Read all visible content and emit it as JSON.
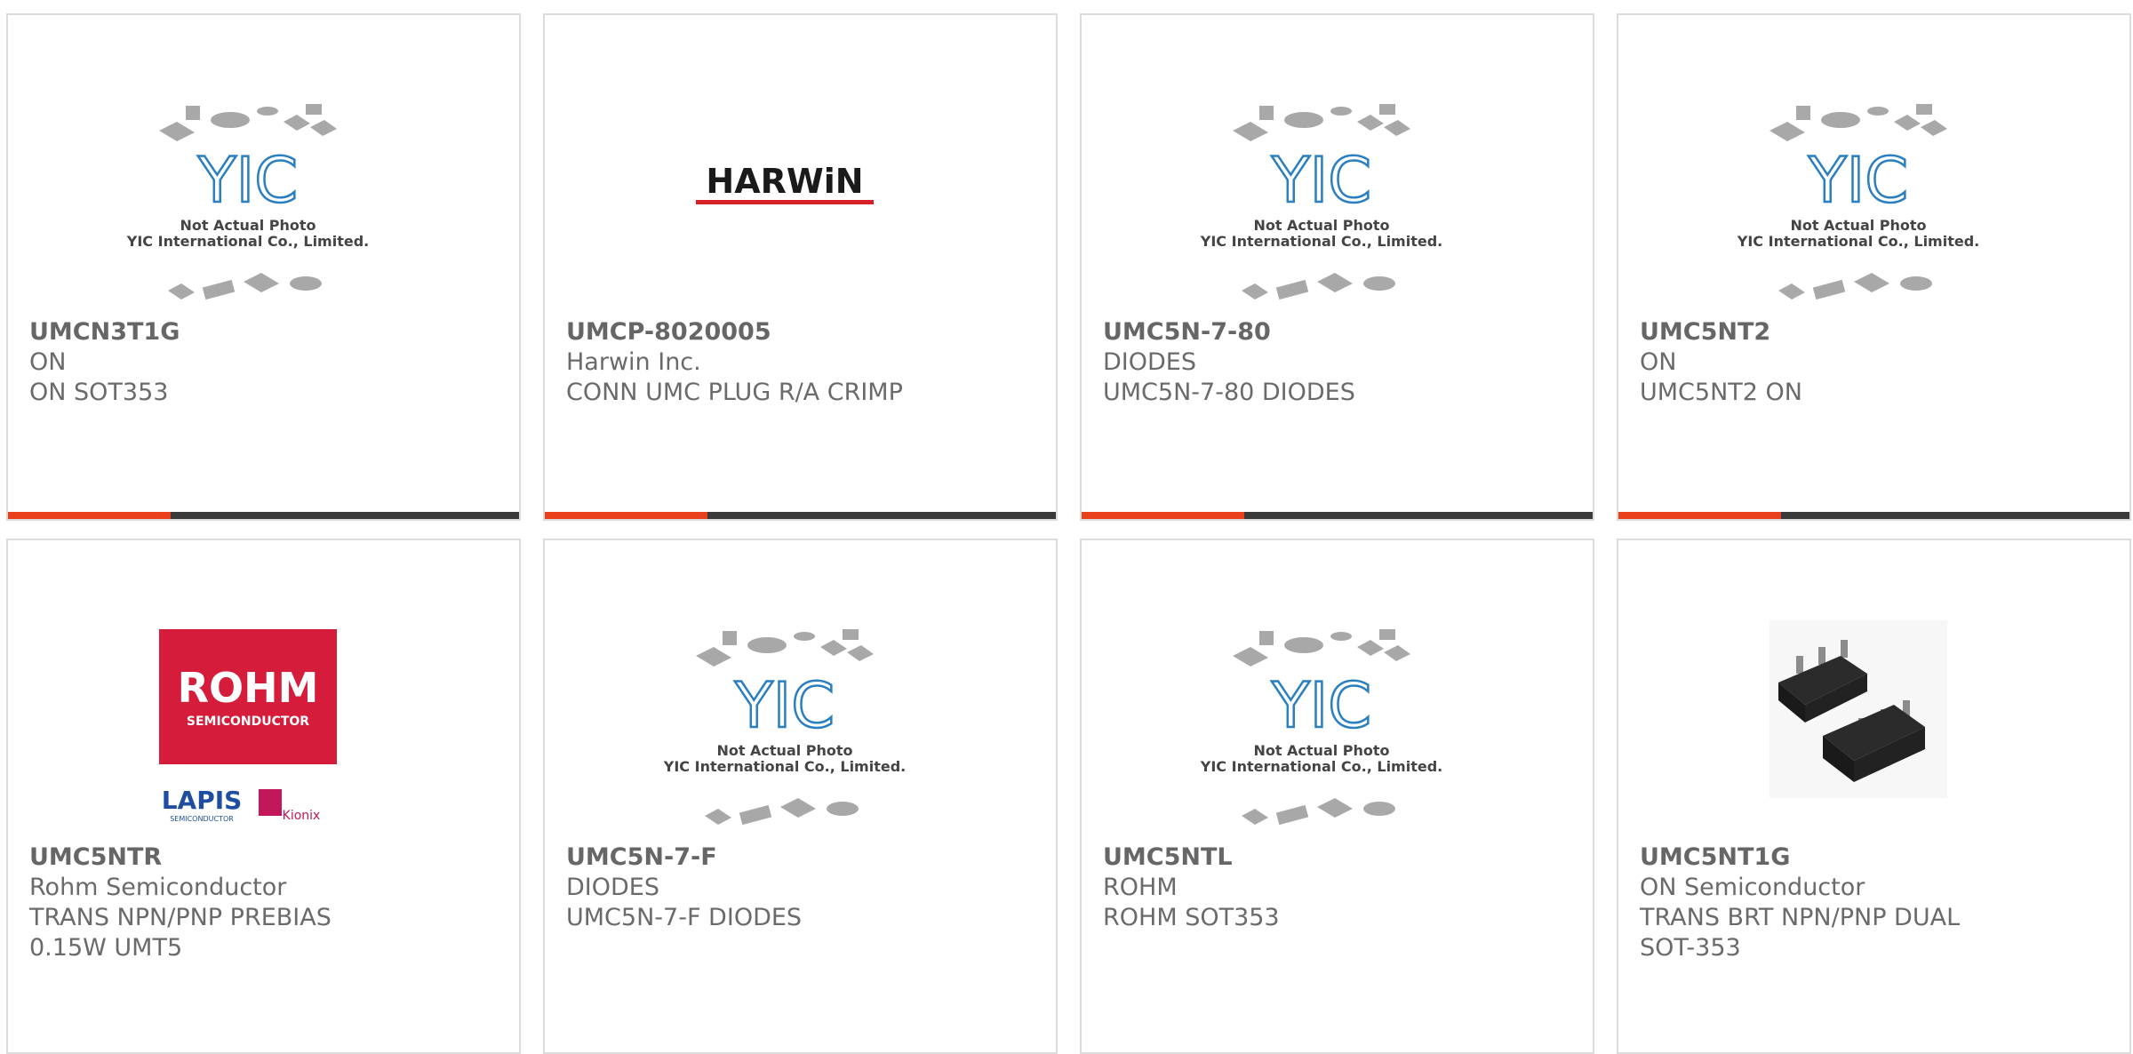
{
  "colors": {
    "accent": "#e8411b",
    "bar": "#3a3a3a",
    "border": "#dcdcdc",
    "text": "#666666",
    "yic_blue": "#2a7fc1",
    "rohm_red": "#d51c3a",
    "harwin_red": "#d52027"
  },
  "placeholder": {
    "line1": "Not Actual Photo",
    "line2": "YIC International Co., Limited.",
    "logo": "YIC"
  },
  "brands": {
    "harwin": "HARWiN",
    "rohm": "ROHM",
    "rohm_sub": "SEMICONDUCTOR",
    "lapis": "LAPIS",
    "lapis_sub": "SEMICONDUCTOR",
    "kionix": "Kionix"
  },
  "products": [
    {
      "part": "UMCN3T1G",
      "maker": "ON",
      "desc": "ON SOT353",
      "image": "yic-placeholder"
    },
    {
      "part": "UMCP-8020005",
      "maker": "Harwin Inc.",
      "desc": "CONN UMC PLUG R/A CRIMP",
      "image": "harwin-logo"
    },
    {
      "part": "UMC5N-7-80",
      "maker": "DIODES",
      "desc": "UMC5N-7-80 DIODES",
      "image": "yic-placeholder"
    },
    {
      "part": "UMC5NT2",
      "maker": "ON",
      "desc": "UMC5NT2 ON",
      "image": "yic-placeholder"
    },
    {
      "part": "UMC5NTR",
      "maker": "Rohm Semiconductor",
      "desc": "TRANS NPN/PNP PREBIAS 0.15W UMT5",
      "image": "rohm-logo"
    },
    {
      "part": "UMC5N-7-F",
      "maker": "DIODES",
      "desc": "UMC5N-7-F DIODES",
      "image": "yic-placeholder"
    },
    {
      "part": "UMC5NTL",
      "maker": "ROHM",
      "desc": "ROHM SOT353",
      "image": "yic-placeholder"
    },
    {
      "part": "UMC5NT1G",
      "maker": "ON Semiconductor",
      "desc": "TRANS BRT NPN/PNP DUAL SOT-353",
      "image": "sot353-photo"
    }
  ]
}
